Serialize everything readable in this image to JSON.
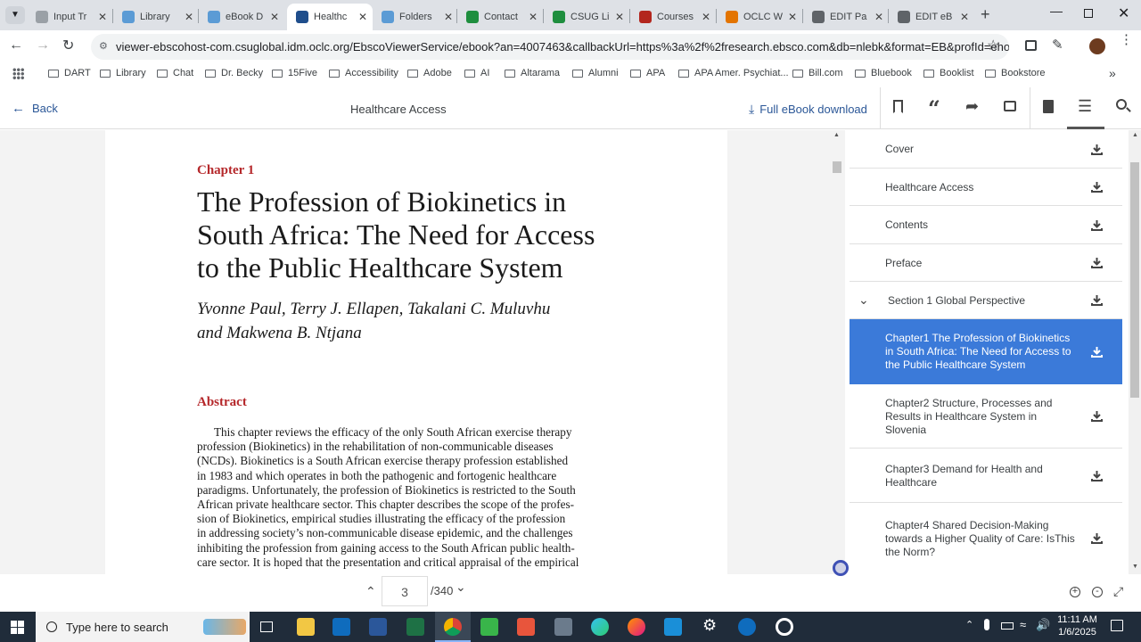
{
  "browser": {
    "tabs": [
      {
        "title": "Input Tr",
        "color": "#9aa0a6"
      },
      {
        "title": "Library",
        "color": "#5b9bd5"
      },
      {
        "title": "eBook D",
        "color": "#5b9bd5"
      },
      {
        "title": "Healthc",
        "color": "#1f4e8c",
        "active": true
      },
      {
        "title": "Folders",
        "color": "#5b9bd5"
      },
      {
        "title": "Contact",
        "color": "#1e8e3e"
      },
      {
        "title": "CSUG Li",
        "color": "#1e8e3e"
      },
      {
        "title": "Courses",
        "color": "#b3261e"
      },
      {
        "title": "OCLC W",
        "color": "#e37400"
      },
      {
        "title": "EDIT Pa",
        "color": "#5f6368"
      },
      {
        "title": "EDIT eB",
        "color": "#5f6368"
      }
    ],
    "url": "viewer-ebscohost-com.csuglobal.idm.oclc.org/EbscoViewerService/ebook?an=4007463&callbackUrl=https%3a%2f%2fresearch.ebsco.com&db=nlebk&format=EB&profId=ehost&lpid=lp...",
    "bookmarks": [
      "DART",
      "Library",
      "Chat",
      "Dr. Becky",
      "15Five",
      "Accessibility",
      "Adobe",
      "AI",
      "Altarama",
      "Alumni",
      "APA",
      "APA Amer. Psychiat...",
      "Bill.com",
      "Bluebook",
      "Booklist",
      "Bookstore"
    ]
  },
  "header": {
    "back_label": "Back",
    "title": "Healthcare Access",
    "download_label": "Full eBook download"
  },
  "page": {
    "chapter_label": "Chapter 1",
    "title_lines": [
      "The Profession of Biokinetics in",
      "South Africa: The Need for Access",
      "to the Public Healthcare System"
    ],
    "author_lines": [
      "Yvonne Paul, Terry J. Ellapen, Takalani C. Muluvhu",
      "and Makwena B. Ntjana"
    ],
    "abstract_heading": "Abstract",
    "abstract_lines": [
      "This chapter reviews the efficacy of the only South African exercise therapy",
      "profession (Biokinetics) in the rehabilitation of non-communicable diseases",
      "(NCDs). Biokinetics is a South African exercise therapy profession established",
      "in 1983 and which operates in both the pathogenic and fortogenic healthcare",
      "paradigms. Unfortunately, the profession of Biokinetics is restricted to the South",
      "African private healthcare sector. This chapter describes the scope of the profes-",
      "sion of Biokinetics, empirical studies illustrating the efficacy of the profession",
      "in addressing society’s non-communicable disease epidemic, and the challenges",
      "inhibiting the profession from gaining access to the South African public health-",
      "care sector. It is hoped that the presentation and critical appraisal of the empirical"
    ]
  },
  "toc": {
    "items": [
      {
        "label": "Cover"
      },
      {
        "label": "Healthcare Access"
      },
      {
        "label": "Contents"
      },
      {
        "label": "Preface"
      },
      {
        "label": "Section 1 Global Perspective",
        "expandable": true
      },
      {
        "label": "Chapter1 The Profession of Biokinetics in South Africa: The Need for Access to the Public Healthcare System",
        "selected": true
      },
      {
        "label": "Chapter2 Structure, Processes and Results in Healthcare System in Slovenia"
      },
      {
        "label": "Chapter3 Demand for Health and Healthcare"
      },
      {
        "label": "Chapter4 Shared Decision-Making towards a Higher Quality of Care: IsThis the Norm?"
      }
    ]
  },
  "pager": {
    "current": "3",
    "total": "/340"
  },
  "taskbar": {
    "search_placeholder": "Type here to search",
    "time": "11:11 AM",
    "date": "1/6/2025"
  },
  "colors": {
    "accent": "#3b7ad9",
    "link": "#2b5797",
    "chapter_red": "#b5282b"
  }
}
